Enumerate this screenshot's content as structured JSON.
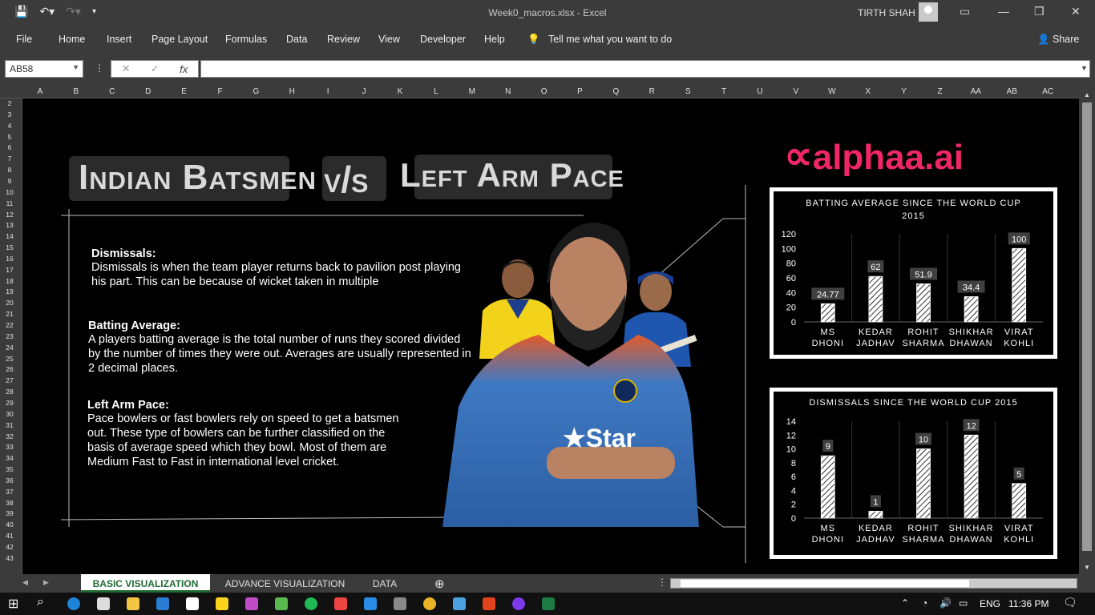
{
  "window": {
    "title": "Week0_macros.xlsx  -  Excel",
    "user": "TIRTH SHAH"
  },
  "ribbon": {
    "tabs": [
      "File",
      "Home",
      "Insert",
      "Page Layout",
      "Formulas",
      "Data",
      "Review",
      "View",
      "Developer",
      "Help"
    ],
    "tell_me": "Tell me what you want to do",
    "share": "Share"
  },
  "formula_bar": {
    "name_box": "AB58",
    "fx": "fx",
    "value": ""
  },
  "columns": [
    "A",
    "B",
    "C",
    "D",
    "E",
    "F",
    "G",
    "H",
    "I",
    "J",
    "K",
    "L",
    "M",
    "N",
    "O",
    "P",
    "Q",
    "R",
    "S",
    "T",
    "U",
    "V",
    "W",
    "X",
    "Y",
    "Z",
    "AA",
    "AB",
    "AC"
  ],
  "rows": [
    "2",
    "3",
    "4",
    "5",
    "6",
    "7",
    "8",
    "9",
    "10",
    "11",
    "12",
    "13",
    "14",
    "15",
    "16",
    "17",
    "18",
    "19",
    "20",
    "21",
    "22",
    "23",
    "24",
    "25",
    "26",
    "27",
    "28",
    "29",
    "30",
    "31",
    "32",
    "33",
    "34",
    "35",
    "36",
    "37",
    "38",
    "39",
    "40",
    "41",
    "42",
    "43"
  ],
  "dashboard": {
    "title_left": "Indian Batsmen",
    "title_vs": "v/s",
    "title_right": "Left Arm Pace",
    "logo": "alphaa.ai",
    "sections": [
      {
        "heading": "Dismissals:",
        "text": "Dismissals is when the team player returns back to pavilion post playing his part. This can be because of wicket taken in multiple"
      },
      {
        "heading": "Batting Average:",
        "text": "A players batting average is the total number of runs they scored divided by the number of times they were out. Averages are usually represented in 2 decimal places."
      },
      {
        "heading": "Left Arm Pace:",
        "text": "Pace bowlers or fast bowlers rely on speed to get a batsmen out. These type of bowlers can be further classified on the basis of average speed which they bowl. Most of them are Medium Fast to Fast in international level cricket."
      }
    ]
  },
  "chart_data": [
    {
      "type": "bar",
      "title": "BATTING AVERAGE SINCE THE WORLD CUP 2015",
      "categories": [
        "MS DHONI",
        "KEDAR JADHAV",
        "ROHIT SHARMA",
        "SHIKHAR DHAWAN",
        "VIRAT KOHLI"
      ],
      "values": [
        24.77,
        62,
        51.9,
        34.4,
        100
      ],
      "value_labels": [
        "24.77",
        "62",
        "51.9",
        "34.4",
        "100"
      ],
      "yticks": [
        "0",
        "20",
        "40",
        "60",
        "80",
        "100",
        "120"
      ],
      "ylim": [
        0,
        120
      ]
    },
    {
      "type": "bar",
      "title": "DISMISSALS SINCE THE WORLD CUP 2015",
      "categories": [
        "MS DHONI",
        "KEDAR JADHAV",
        "ROHIT SHARMA",
        "SHIKHAR DHAWAN",
        "VIRAT KOHLI"
      ],
      "values": [
        9,
        1,
        10,
        12,
        5
      ],
      "value_labels": [
        "9",
        "1",
        "10",
        "12",
        "5"
      ],
      "yticks": [
        "0",
        "2",
        "4",
        "6",
        "8",
        "10",
        "12",
        "14"
      ],
      "ylim": [
        0,
        14
      ]
    }
  ],
  "sheet_tabs": [
    "BASIC VISUALIZATION",
    "ADVANCE VISUALIZATION",
    "DATA"
  ],
  "taskbar": {
    "language": "ENG",
    "time": "11:36 PM"
  }
}
